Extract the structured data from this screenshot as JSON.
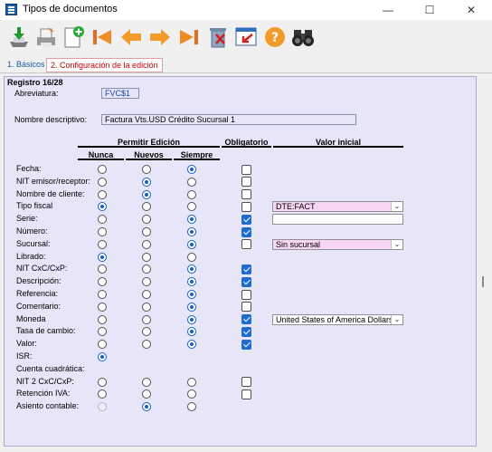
{
  "window": {
    "title": "Tipos de documentos",
    "minimize": "—",
    "maximize": "☐",
    "close": "✕"
  },
  "toolbar": {
    "buttons": [
      "save-icon",
      "print-icon",
      "new-document-icon",
      "first-record-icon",
      "previous-record-icon",
      "next-record-icon",
      "last-record-icon",
      "delete-icon",
      "exit-icon",
      "help-icon",
      "find-icon"
    ]
  },
  "tabs": [
    {
      "label": "1. Básicos",
      "active": false
    },
    {
      "label": "2. Configuración de la edición",
      "active": true
    }
  ],
  "form": {
    "record": "Registro 16/28",
    "abbreviation_label": "Abreviatura:",
    "abbreviation_value": "FVC$1",
    "description_label": "Nombre descriptivo:",
    "description_value": "Factura Vts.USD Crédito Sucursal 1"
  },
  "grid": {
    "header_permitir": "Permitir Edición",
    "header_obligatorio": "Obligatorio",
    "header_valor": "Valor inicial",
    "col_nunca": "Nunca",
    "col_nuevos": "Nuevos",
    "col_siempre": "Siempre",
    "rows": [
      {
        "label": "Fecha:",
        "edit": "siempre",
        "mandatory": false,
        "value_type": "none",
        "value": ""
      },
      {
        "label": "NIT emisor/receptor:",
        "edit": "nuevos",
        "mandatory": false,
        "value_type": "none",
        "value": ""
      },
      {
        "label": "Nombre de cliente:",
        "edit": "nuevos",
        "mandatory": false,
        "value_type": "none",
        "value": ""
      },
      {
        "label": "Tipo fiscal",
        "edit": "nunca",
        "mandatory": false,
        "value_type": "combo",
        "value": "DTE:FACT",
        "bg": "#f6d6f2"
      },
      {
        "label": "Serie:",
        "edit": "siempre",
        "mandatory": true,
        "value_type": "text",
        "value": ""
      },
      {
        "label": "Número:",
        "edit": "siempre",
        "mandatory": true,
        "value_type": "none",
        "value": ""
      },
      {
        "label": "Sucursal:",
        "edit": "siempre",
        "mandatory": false,
        "value_type": "combo",
        "value": "Sin sucursal",
        "bg": "#f6d6f2"
      },
      {
        "label": "Librado:",
        "edit": "nunca",
        "mandatory": null,
        "value_type": "none",
        "value": ""
      },
      {
        "label": "NIT CxC/CxP:",
        "edit": "siempre",
        "mandatory": true,
        "value_type": "none",
        "value": ""
      },
      {
        "label": "Descripción:",
        "edit": "siempre",
        "mandatory": true,
        "value_type": "none",
        "value": ""
      },
      {
        "label": "Referencia:",
        "edit": "siempre",
        "mandatory": false,
        "value_type": "none",
        "value": ""
      },
      {
        "label": "Comentario:",
        "edit": "siempre",
        "mandatory": false,
        "value_type": "none",
        "value": ""
      },
      {
        "label": "Moneda",
        "edit": "siempre",
        "mandatory": true,
        "value_type": "combo",
        "value": "United States of America Dollars",
        "bg": "#ffffff"
      },
      {
        "label": "Tasa de cambio:",
        "edit": "siempre",
        "mandatory": true,
        "value_type": "none",
        "value": ""
      },
      {
        "label": "Valor:",
        "edit": "siempre",
        "mandatory": true,
        "value_type": "none",
        "value": ""
      },
      {
        "label": "ISR:",
        "edit": "nunca",
        "mandatory": null,
        "value_type": "none",
        "value": "",
        "no_radios": [
          "nuevos",
          "siempre"
        ]
      },
      {
        "label": "Cuenta cuadrática:",
        "edit": "none",
        "mandatory": null,
        "value_type": "none",
        "value": "",
        "no_radios": [
          "nunca",
          "nuevos",
          "siempre"
        ]
      },
      {
        "label": "NIT 2 CxC/CxP:",
        "edit": "none",
        "mandatory": false,
        "value_type": "none",
        "value": ""
      },
      {
        "label": "Retención IVA:",
        "edit": "none",
        "mandatory": false,
        "value_type": "none",
        "value": ""
      },
      {
        "label": "Asiento contable:",
        "edit": "nuevos",
        "mandatory": null,
        "value_type": "none",
        "value": "",
        "disabled_radios": [
          "nunca"
        ]
      }
    ]
  },
  "colors": {
    "panel_bg": "#e6e6f8",
    "radio_on": "#1560c0",
    "check_on": "#1f6bd0",
    "combo_pink": "#f6d6f2",
    "tab_active": "#c00000",
    "tab_inactive": "#1c5ca8"
  }
}
